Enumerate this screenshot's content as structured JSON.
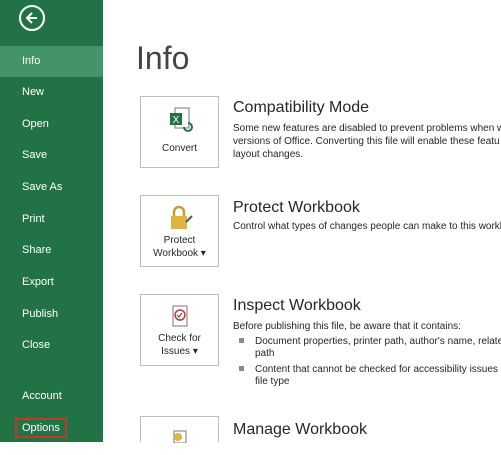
{
  "sidebar": {
    "items": [
      {
        "label": "Info"
      },
      {
        "label": "New"
      },
      {
        "label": "Open"
      },
      {
        "label": "Save"
      },
      {
        "label": "Save As"
      },
      {
        "label": "Print"
      },
      {
        "label": "Share"
      },
      {
        "label": "Export"
      },
      {
        "label": "Publish"
      },
      {
        "label": "Close"
      },
      {
        "label": "Account"
      },
      {
        "label": "Options"
      }
    ]
  },
  "main": {
    "title": "Info",
    "sections": [
      {
        "button_label": "Convert",
        "title": "Compatibility Mode",
        "desc": [
          "Some new features are disabled to prevent problems when w",
          "versions of Office. Converting this file will enable these featu",
          "layout changes."
        ]
      },
      {
        "button_line1": "Protect",
        "button_line2": "Workbook ▾",
        "title": "Protect Workbook",
        "desc": [
          "Control what types of changes people can make to this workb"
        ]
      },
      {
        "button_line1": "Check for",
        "button_line2": "Issues ▾",
        "title": "Inspect Workbook",
        "desc": [
          "Before publishing this file, be aware that it contains:"
        ],
        "bullets": [
          {
            "line1": "Document properties, printer path, author's name, relate",
            "line2": "path"
          },
          {
            "line1": "Content that cannot be checked for accessibility issues b",
            "line2": "file type"
          }
        ]
      },
      {
        "title": "Manage Workbook"
      }
    ]
  },
  "colors": {
    "sidebar": "#217346",
    "active": "#439467",
    "highlight": "#c0392b"
  }
}
